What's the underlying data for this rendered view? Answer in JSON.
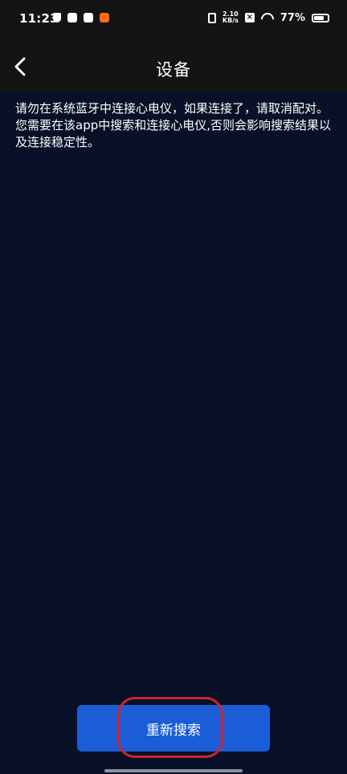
{
  "status_bar": {
    "time": "11:23",
    "net_speed_value": "2.10",
    "net_speed_unit": "KB/s",
    "battery_percent": "77%",
    "battery_level": 0.77,
    "left_icons": [
      "shield-icon",
      "app-icon",
      "mail-icon",
      "app-badge-icon"
    ],
    "right_icons": [
      "vibrate-icon",
      "sim-x-icon",
      "wifi-icon",
      "battery-icon"
    ]
  },
  "header": {
    "title": "设备",
    "back_icon": "chevron-left-icon"
  },
  "notice": {
    "text": "请勿在系统蓝牙中连接心电仪，如果连接了，请取消配对。您需要在该app中搜索和连接心电仪,否则会影响搜索结果以及连接稳定性。"
  },
  "actions": {
    "research_label": "重新搜索"
  },
  "colors": {
    "background": "#081127",
    "header": "#141414",
    "button": "#1b5dd6",
    "highlight": "#d3222c"
  }
}
